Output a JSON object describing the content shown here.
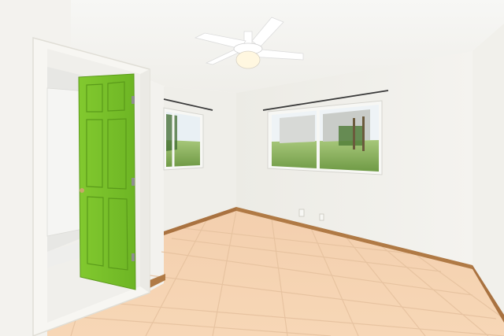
{
  "scene": {
    "description_hidden": "",
    "palette": {
      "ceiling": "#f4f4f2",
      "wall_left": "#f3f2ee",
      "wall_back": "#f1efe9",
      "wall_right": "#f2f1ec",
      "floor": "#f5d3b0",
      "grout": "#e8c6a4",
      "baseboard": "#b07a45",
      "door": "#7cc42a",
      "door_dark": "#5fa31c",
      "window_sky": "#e9f0f4",
      "window_grass": "#86b25a",
      "window_tree": "#3f6b2f",
      "rod": "#3a3a3a",
      "fan": "#ffffff",
      "light": "#fff7e0"
    },
    "objects": {
      "ceiling_fan": "ceiling-fan",
      "door": "open-door",
      "window_left": "window",
      "window_right": "window",
      "outlet": "wall-outlet"
    }
  }
}
